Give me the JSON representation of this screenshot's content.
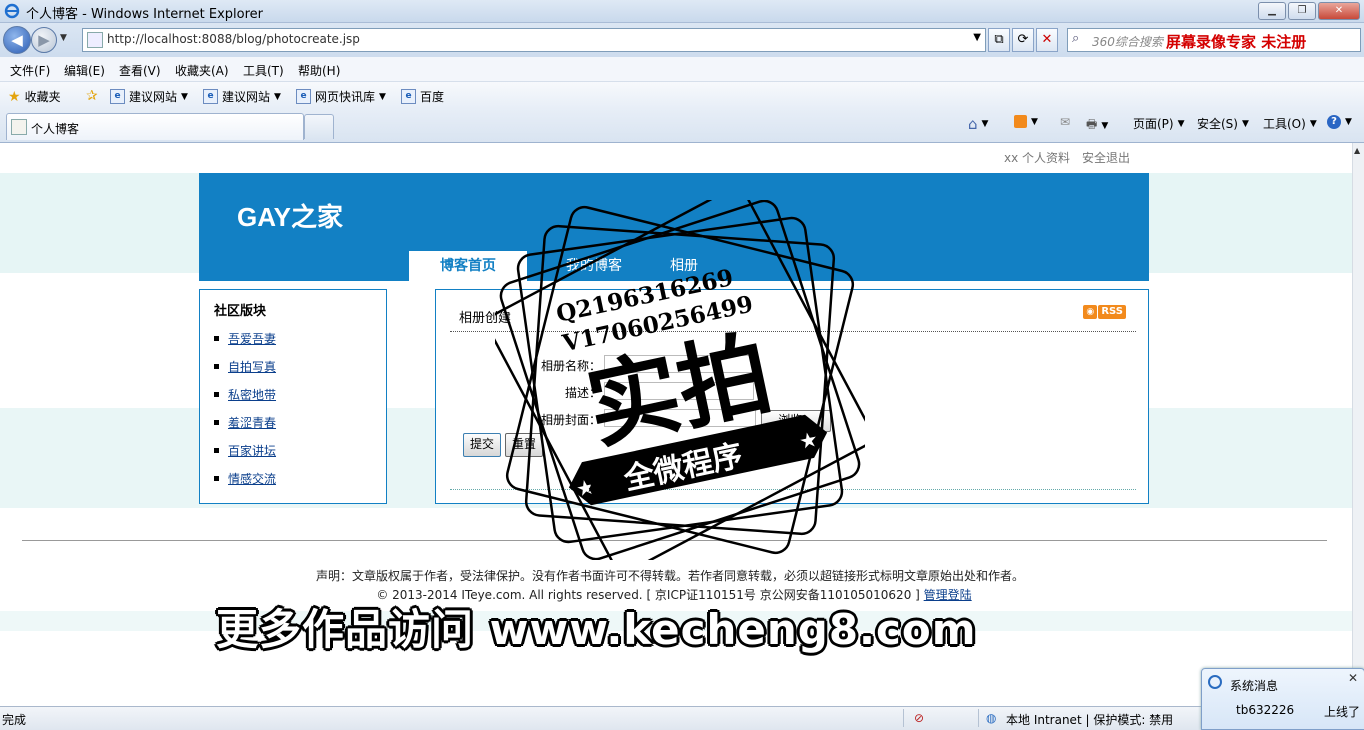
{
  "window": {
    "title": "个人博客 - Windows Internet Explorer",
    "url": "http://localhost:8088/blog/photocreate.jsp",
    "search_placeholder": "360综合搜索",
    "search_promo": "屏幕录像专家 未注册"
  },
  "menu": [
    "文件(F)",
    "编辑(E)",
    "查看(V)",
    "收藏夹(A)",
    "工具(T)",
    "帮助(H)"
  ],
  "favorites": {
    "label": "收藏夹",
    "items": [
      "建议网站",
      "建议网站",
      "网页快讯库",
      "百度"
    ]
  },
  "tab": {
    "title": "个人博客"
  },
  "commands": {
    "page": "页面(P)",
    "safety": "安全(S)",
    "tools": "工具(O)"
  },
  "page": {
    "top_links": [
      "xx 个人资料",
      "安全退出"
    ],
    "site_title": "GAY之家",
    "nav": [
      "博客首页",
      "我的博客",
      "相册"
    ],
    "sidebar": {
      "heading": "社区版块",
      "items": [
        "吾爱吾妻",
        "自拍写真",
        "私密地带",
        "羞涩青春",
        "百家讲坛",
        "情感交流"
      ]
    },
    "main": {
      "heading": "相册创建",
      "rss": "RSS",
      "form": {
        "name_label": "相册名称：",
        "desc_label": "描述：",
        "cover_label": "相册封面：",
        "browse": "浏览...",
        "submit": "提交",
        "reset": "重置"
      }
    },
    "footer": {
      "declaration": "声明：文章版权属于作者，受法律保护。没有作者书面许可不得转载。若作者同意转载，必须以超链接形式标明文章原始出处和作者。",
      "copyright": "© 2013-2014 ITeye.com. All rights reserved. [ 京ICP证110151号 京公网安备110105010620 ]",
      "admin_link": "管理登陆"
    }
  },
  "watermark": {
    "qq": "Q2196316269",
    "wechat": "V17060256499",
    "big": "实拍",
    "banner": "全微程序",
    "bottom": "更多作品访问 www.kecheng8.com"
  },
  "status": {
    "left": "完成",
    "zone": "本地 Intranet | 保护模式: 禁用"
  },
  "popup": {
    "title": "系统消息",
    "user": "tb632226",
    "message": "上线了"
  }
}
